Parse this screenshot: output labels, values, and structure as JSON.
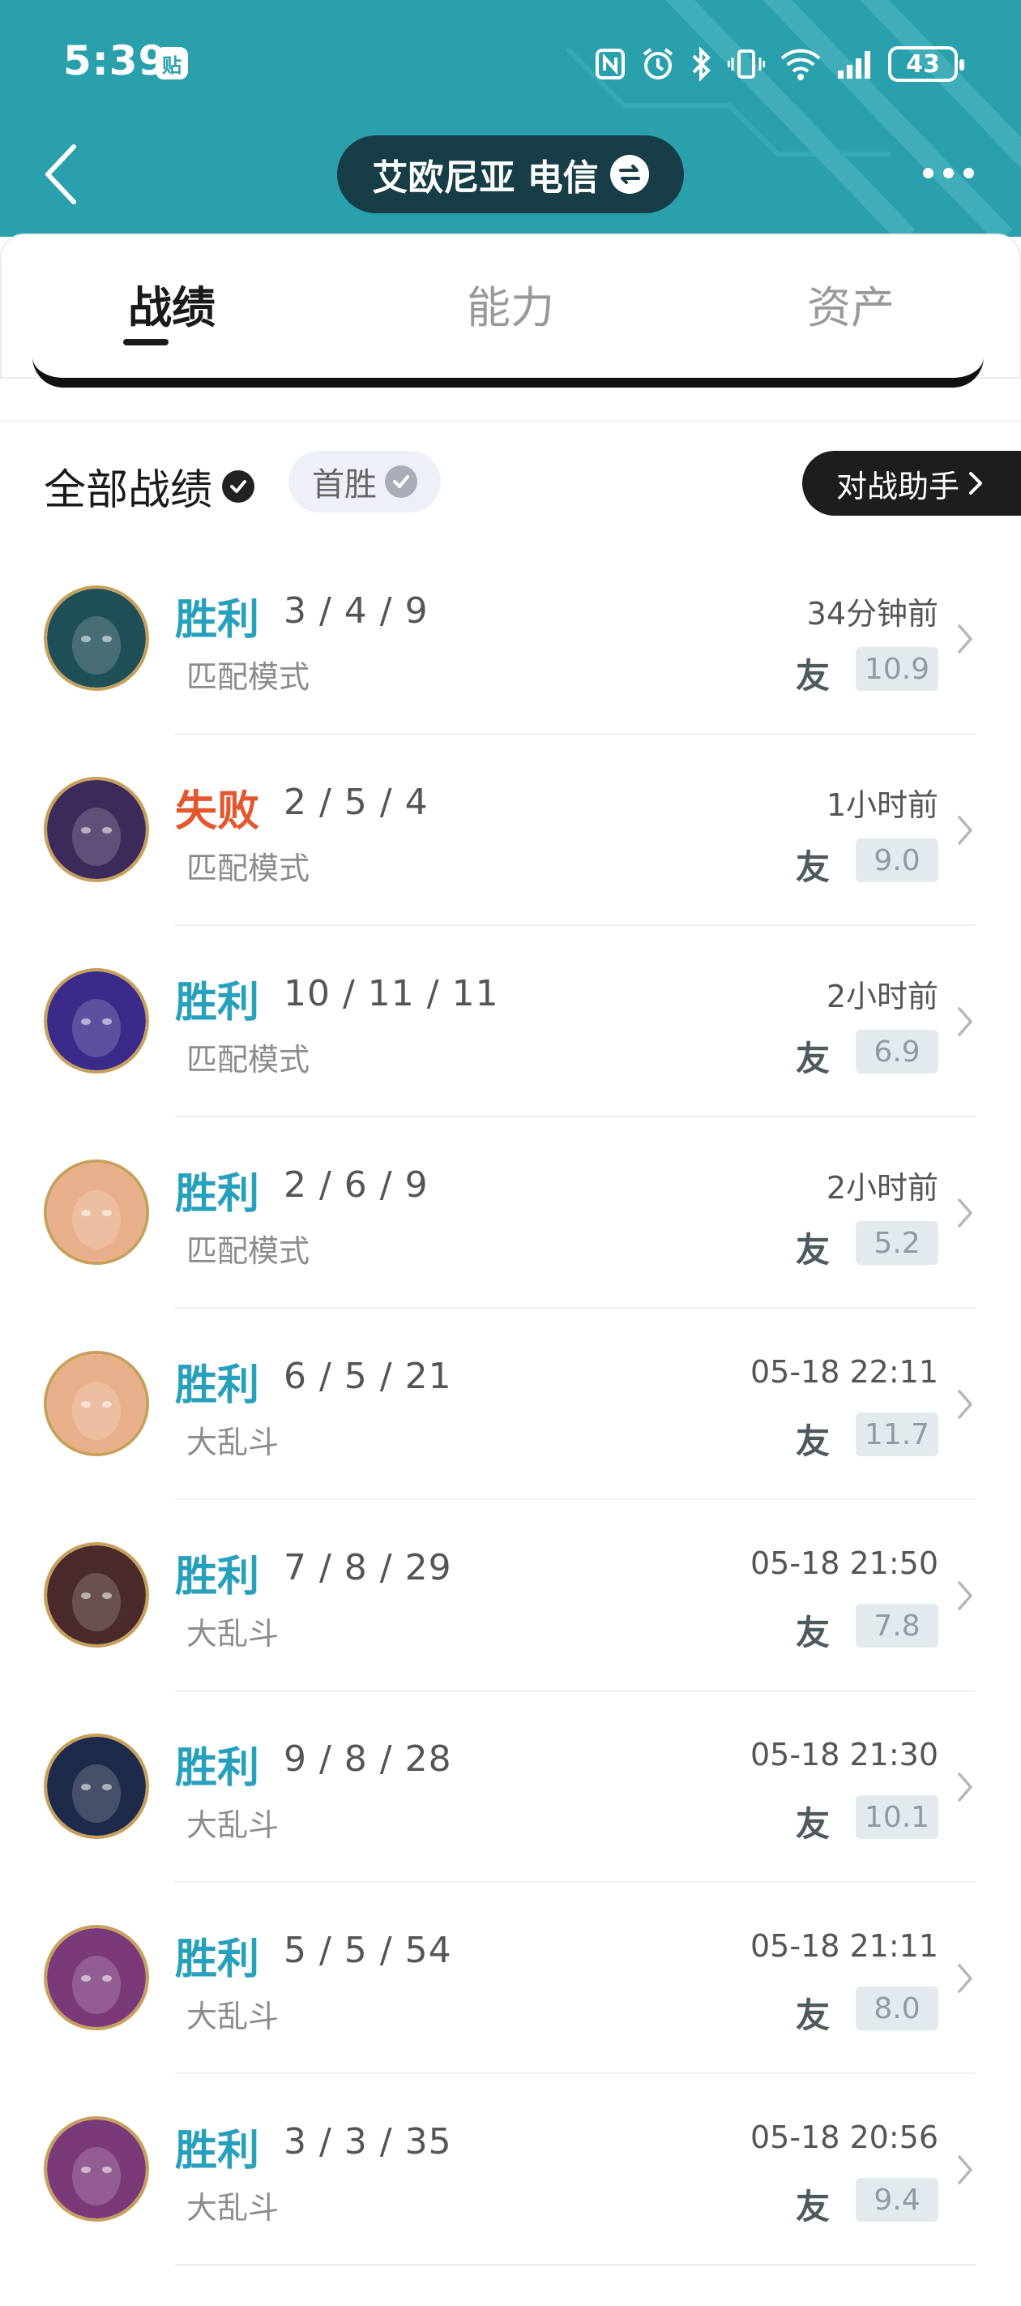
{
  "status_bar": {
    "time": "5:39",
    "sticker_label": "贴",
    "battery": "43"
  },
  "header": {
    "server_name": "艾欧尼亚 电信"
  },
  "tabs": [
    {
      "label": "战绩",
      "active": true
    },
    {
      "label": "能力",
      "active": false
    },
    {
      "label": "资产",
      "active": false
    }
  ],
  "filter": {
    "all_records_label": "全部战绩",
    "first_win_label": "首胜",
    "assistant_label": "对战助手"
  },
  "matches": [
    {
      "result": "胜利",
      "outcome": "win",
      "kda": "3 / 4 / 9",
      "mode": "匹配模式",
      "time": "34分钟前",
      "friend_icon": "友",
      "score": "10.9",
      "avatar_color": "#1f4f57"
    },
    {
      "result": "失败",
      "outcome": "loss",
      "kda": "2 / 5 / 4",
      "mode": "匹配模式",
      "time": "1小时前",
      "friend_icon": "友",
      "score": "9.0",
      "avatar_color": "#3b2a5a"
    },
    {
      "result": "胜利",
      "outcome": "win",
      "kda": "10 / 11 / 11",
      "mode": "匹配模式",
      "time": "2小时前",
      "friend_icon": "友",
      "score": "6.9",
      "avatar_color": "#3a2a8a"
    },
    {
      "result": "胜利",
      "outcome": "win",
      "kda": "2 / 6 / 9",
      "mode": "匹配模式",
      "time": "2小时前",
      "friend_icon": "友",
      "score": "5.2",
      "avatar_color": "#e8b08a"
    },
    {
      "result": "胜利",
      "outcome": "win",
      "kda": "6 / 5 / 21",
      "mode": "大乱斗",
      "time": "05-18 22:11",
      "friend_icon": "友",
      "score": "11.7",
      "avatar_color": "#e8b08a"
    },
    {
      "result": "胜利",
      "outcome": "win",
      "kda": "7 / 8 / 29",
      "mode": "大乱斗",
      "time": "05-18 21:50",
      "friend_icon": "友",
      "score": "7.8",
      "avatar_color": "#4a2a2a"
    },
    {
      "result": "胜利",
      "outcome": "win",
      "kda": "9 / 8 / 28",
      "mode": "大乱斗",
      "time": "05-18 21:30",
      "friend_icon": "友",
      "score": "10.1",
      "avatar_color": "#1e2a4a"
    },
    {
      "result": "胜利",
      "outcome": "win",
      "kda": "5 / 5 / 54",
      "mode": "大乱斗",
      "time": "05-18 21:11",
      "friend_icon": "友",
      "score": "8.0",
      "avatar_color": "#7a3a7a"
    },
    {
      "result": "胜利",
      "outcome": "win",
      "kda": "3 / 3 / 35",
      "mode": "大乱斗",
      "time": "05-18 20:56",
      "friend_icon": "友",
      "score": "9.4",
      "avatar_color": "#7a3a7a"
    }
  ],
  "colors": {
    "header_bg": "#2aa0ad",
    "win": "#27a0bd",
    "loss": "#e4572e",
    "server_pill": "#173d46"
  }
}
